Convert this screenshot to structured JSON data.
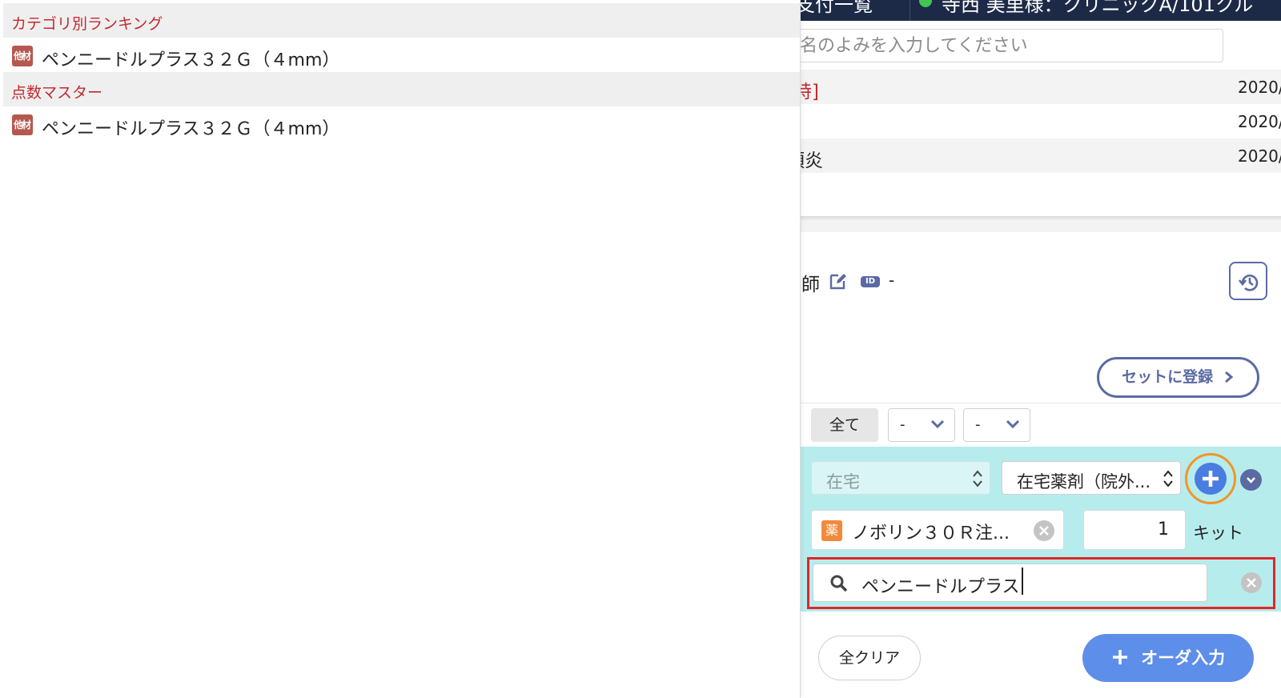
{
  "top_bar": {
    "segments": [
      "支付一覧",
      "寺西 美里様：クリニックA/101クル"
    ],
    "status_color": "#43c454"
  },
  "patient_search": {
    "placeholder": "名のよみを入力してください"
  },
  "history": {
    "rows": [
      {
        "left": "[特]",
        "date": "2020/",
        "shaded": true,
        "accent": true
      },
      {
        "left": "",
        "date": "2020/",
        "shaded": false,
        "accent": false
      },
      {
        "left": "頭炎",
        "date": "2020/",
        "shaded": true,
        "accent": false
      }
    ]
  },
  "doctor": {
    "label": "師",
    "id_badge": "ID",
    "id_value": "-"
  },
  "buttons": {
    "set_register": "セットに登録",
    "filter_all": "全て",
    "clear_all": "全クリア",
    "order_input": "オーダ入力"
  },
  "filters": [
    "-",
    "-"
  ],
  "order": {
    "type_select": "在宅",
    "category_select": "在宅薬剤（院外...",
    "drug_badge": "薬",
    "drug_name": "ノボリン３０Ｒ注...",
    "quantity": "1",
    "unit": "キット",
    "search_text": "ペンニードルプラス"
  },
  "dropdown": {
    "sections": [
      {
        "title": "カテゴリ別ランキング",
        "items": [
          "ペンニードルプラス３２Ｇ（４mm）"
        ]
      },
      {
        "title": "点数マスター",
        "items": [
          "ペンニードルプラス３２Ｇ（４mm）"
        ]
      }
    ],
    "item_badge": "他材"
  },
  "colors": {
    "accent": "#5b6aa3",
    "order_panel": "#b7ecec",
    "primary_button": "#5d8ee9",
    "highlight_ring": "#f29528",
    "selection_frame": "#e0262a",
    "section_text": "#c3292f",
    "material_badge": "#b5584f",
    "drug_badge": "#f28a3b"
  },
  "icons": [
    "edit-icon",
    "history-icon",
    "chevron-right-icon",
    "chevron-down-icon",
    "updown-arrows-icon",
    "plus-icon",
    "search-icon",
    "clear-icon"
  ]
}
